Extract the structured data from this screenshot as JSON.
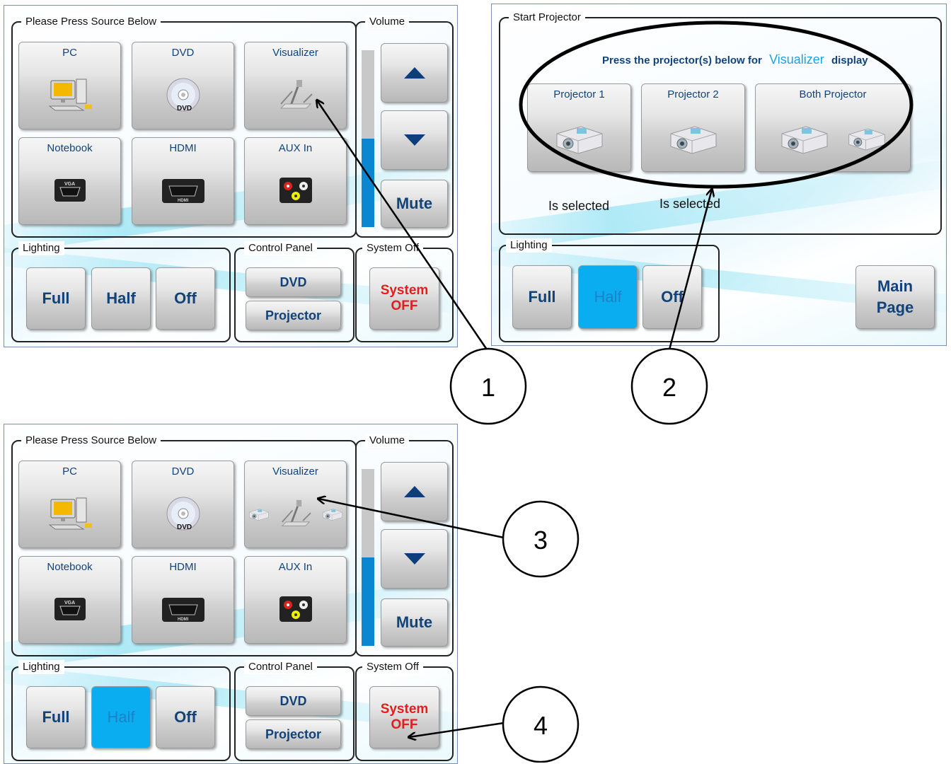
{
  "panel1": {
    "source_legend": "Please Press Source Below",
    "sources": [
      "PC",
      "DVD",
      "Visualizer",
      "Notebook",
      "HDMI",
      "AUX In"
    ],
    "volume_legend": "Volume",
    "volume_level": 0.5,
    "mute_label": "Mute",
    "lighting_legend": "Lighting",
    "lighting_buttons": [
      "Full",
      "Half",
      "Off"
    ],
    "control_legend": "Control Panel",
    "control_buttons": [
      "DVD",
      "Projector"
    ],
    "system_legend": "System Off",
    "system_button": [
      "System",
      "OFF"
    ]
  },
  "panel2": {
    "start_legend": "Start Projector",
    "instruction_prefix": "Press the projector(s) below for",
    "instruction_source": "Visualizer",
    "instruction_suffix": "display",
    "projectors": [
      "Projector 1",
      "Projector 2",
      "Both Projector"
    ],
    "status_1": "Is selected",
    "status_2": "Is selected",
    "lighting_legend": "Lighting",
    "lighting_buttons": [
      "Full",
      "Half",
      "Off"
    ],
    "main_page": [
      "Main",
      "Page"
    ]
  },
  "panel3": {
    "source_legend": "Please Press Source Below",
    "sources": [
      "PC",
      "DVD",
      "Visualizer",
      "Notebook",
      "HDMI",
      "AUX In"
    ],
    "volume_legend": "Volume",
    "volume_level": 0.5,
    "mute_label": "Mute",
    "lighting_legend": "Lighting",
    "lighting_buttons": [
      "Full",
      "Half",
      "Off"
    ],
    "control_legend": "Control Panel",
    "control_buttons": [
      "DVD",
      "Projector"
    ],
    "system_legend": "System Off",
    "system_button": [
      "System",
      "OFF"
    ]
  },
  "callouts": [
    "1",
    "2",
    "3",
    "4"
  ],
  "colors": {
    "accent_blue": "#0aaef0",
    "label_blue": "#11437a",
    "alert_red": "#e41c1c",
    "volume_fill": "#0b86d0"
  },
  "icons": [
    "computer-icon",
    "dvd-disc-icon",
    "visualizer-icon",
    "vga-port-icon",
    "hdmi-port-icon",
    "rca-aux-icon",
    "projector-icon",
    "triangle-up-icon",
    "triangle-down-icon"
  ]
}
